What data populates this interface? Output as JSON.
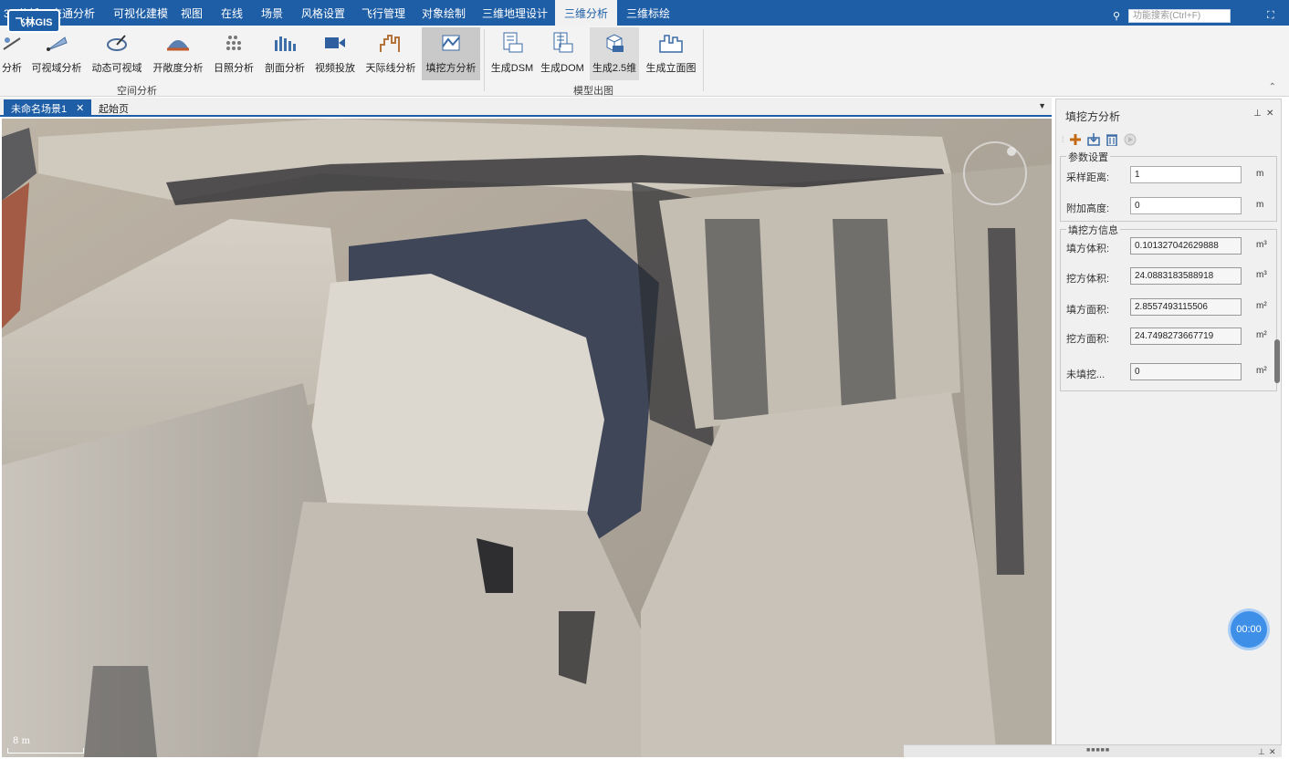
{
  "app": {
    "logo_text": "飞林GIS"
  },
  "menu": {
    "items": [
      "交通分析",
      "可视化建模",
      "视图",
      "在线",
      "场景",
      "风格设置",
      "飞行管理",
      "对象绘制",
      "三维地理设计",
      "三维分析",
      "三维标绘"
    ],
    "active": "三维分析",
    "partial_left": "3D分析"
  },
  "search": {
    "placeholder": "功能搜索(Ctrl+F)"
  },
  "ribbon": {
    "spatial_group_label": "空间分析",
    "model_group_label": "模型出图",
    "buttons": [
      {
        "label": "分析",
        "icon": "sight-analysis-icon"
      },
      {
        "label": "可视域分析",
        "icon": "viewshed-icon"
      },
      {
        "label": "动态可视域",
        "icon": "dynamic-viewshed-icon"
      },
      {
        "label": "开敞度分析",
        "icon": "openness-icon"
      },
      {
        "label": "日照分析",
        "icon": "sunlight-icon"
      },
      {
        "label": "剖面分析",
        "icon": "profile-icon"
      },
      {
        "label": "视频投放",
        "icon": "video-icon"
      },
      {
        "label": "天际线分析",
        "icon": "skyline-icon"
      },
      {
        "label": "填挖方分析",
        "icon": "cut-fill-icon"
      },
      {
        "label": "生成DSM",
        "icon": "dsm-icon"
      },
      {
        "label": "生成DOM",
        "icon": "dom-icon"
      },
      {
        "label": "生成2.5维",
        "icon": "cube-icon"
      },
      {
        "label": "生成立面图",
        "icon": "elevation-icon"
      }
    ]
  },
  "doctabs": {
    "tab1": "未命名场景1",
    "tab2": "起始页"
  },
  "viewport": {
    "scale_text": "8 m"
  },
  "panel": {
    "title": "填挖方分析",
    "params_legend": "参数设置",
    "sample_label": "采样距离:",
    "sample_value": "1",
    "sample_unit": "m",
    "height_label": "附加高度:",
    "height_value": "0",
    "height_unit": "m",
    "info_legend": "填挖方信息",
    "fill_vol_label": "填方体积:",
    "fill_vol_value": "0.101327042629888",
    "cut_vol_label": "挖方体积:",
    "cut_vol_value": "24.0883183588918",
    "vol_unit": "m³",
    "fill_area_label": "填方面积:",
    "fill_area_value": "2.8557493115506",
    "cut_area_label": "挖方面积:",
    "cut_area_value": "24.7498273667719",
    "area_unit": "m²",
    "unfilled_label": "未填挖...",
    "unfilled_value": "0",
    "unfilled_unit": "m²"
  },
  "timer": {
    "text": "00:00"
  }
}
